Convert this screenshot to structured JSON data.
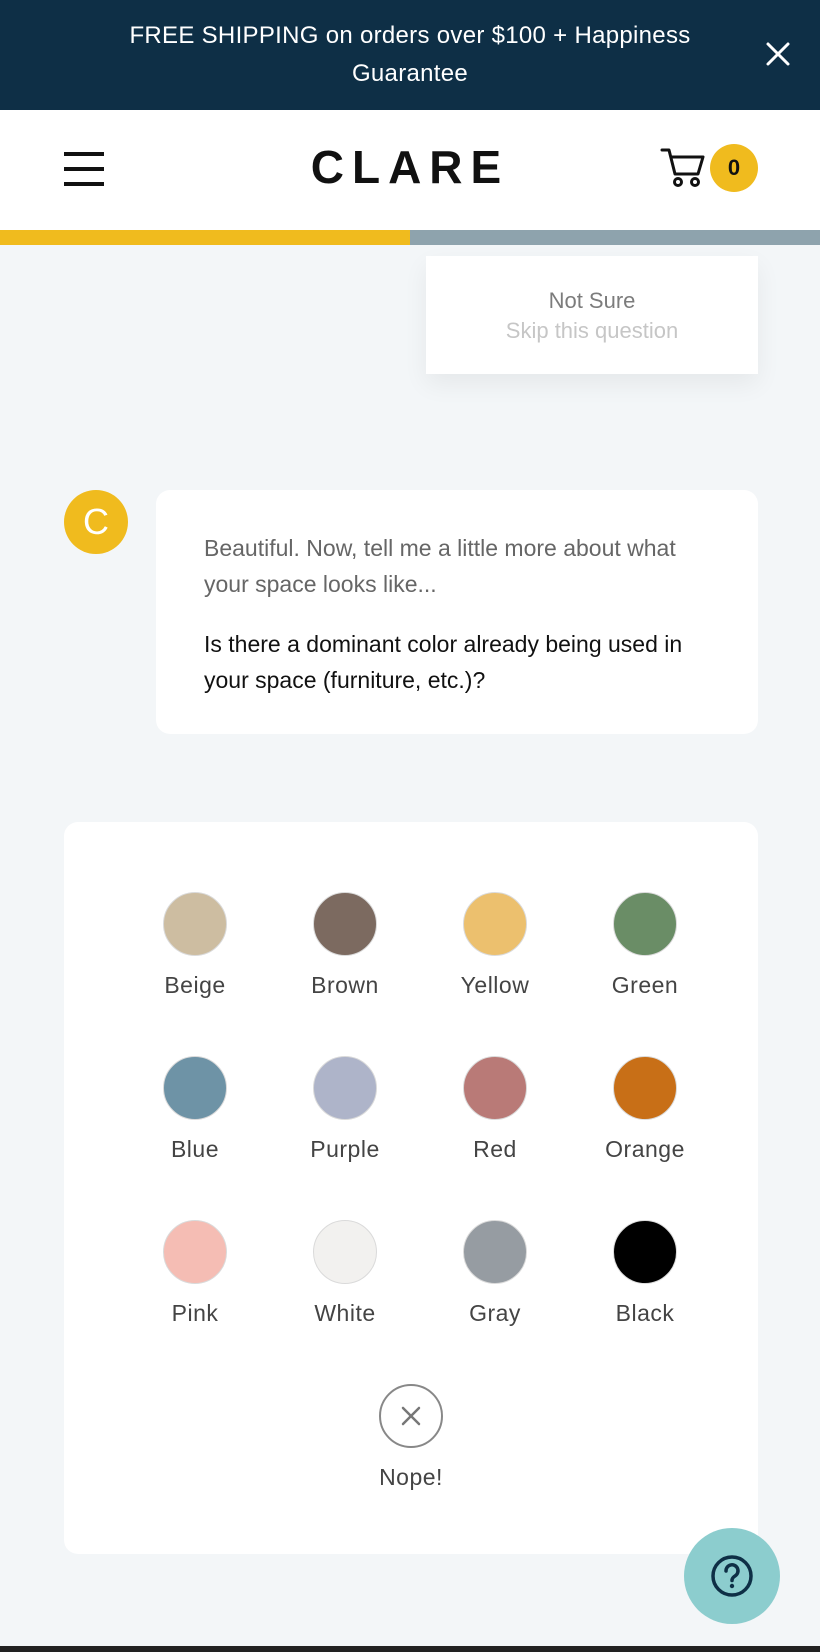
{
  "banner": {
    "text": "FREE SHIPPING on orders over $100 + Happiness Guarantee",
    "close_icon": "close-icon"
  },
  "header": {
    "logo": "CLARE",
    "menu_icon": "hamburger-menu-icon",
    "cart_icon": "cart-icon",
    "cart_count": "0"
  },
  "progress": {
    "fraction": 0.5,
    "fill_color": "#f0bb1e",
    "track_color": "#8ea3ad"
  },
  "not_sure": {
    "title": "Not Sure",
    "subtitle": "Skip this question"
  },
  "chat": {
    "avatar_letter": "C",
    "intro": "Beautiful. Now, tell me a little more about what your space looks like...",
    "question": "Is there a dominant color already being used in your space (furniture, etc.)?"
  },
  "colors": [
    {
      "label": "Beige",
      "hex": "#cdbda1"
    },
    {
      "label": "Brown",
      "hex": "#7c6a60"
    },
    {
      "label": "Yellow",
      "hex": "#ecc06e"
    },
    {
      "label": "Green",
      "hex": "#6a8d66"
    },
    {
      "label": "Blue",
      "hex": "#6e93a6"
    },
    {
      "label": "Purple",
      "hex": "#aeb4c9"
    },
    {
      "label": "Red",
      "hex": "#b97a77"
    },
    {
      "label": "Orange",
      "hex": "#c86f17"
    },
    {
      "label": "Pink",
      "hex": "#f5bdb4"
    },
    {
      "label": "White",
      "hex": "#f2f1ef"
    },
    {
      "label": "Gray",
      "hex": "#969ca2"
    },
    {
      "label": "Black",
      "hex": "#000000"
    }
  ],
  "nope": {
    "label": "Nope!",
    "icon": "x-icon"
  },
  "help": {
    "icon": "question-mark-icon"
  },
  "accent_color": "#f0bb1e",
  "brand_dark": "#0e2f46"
}
